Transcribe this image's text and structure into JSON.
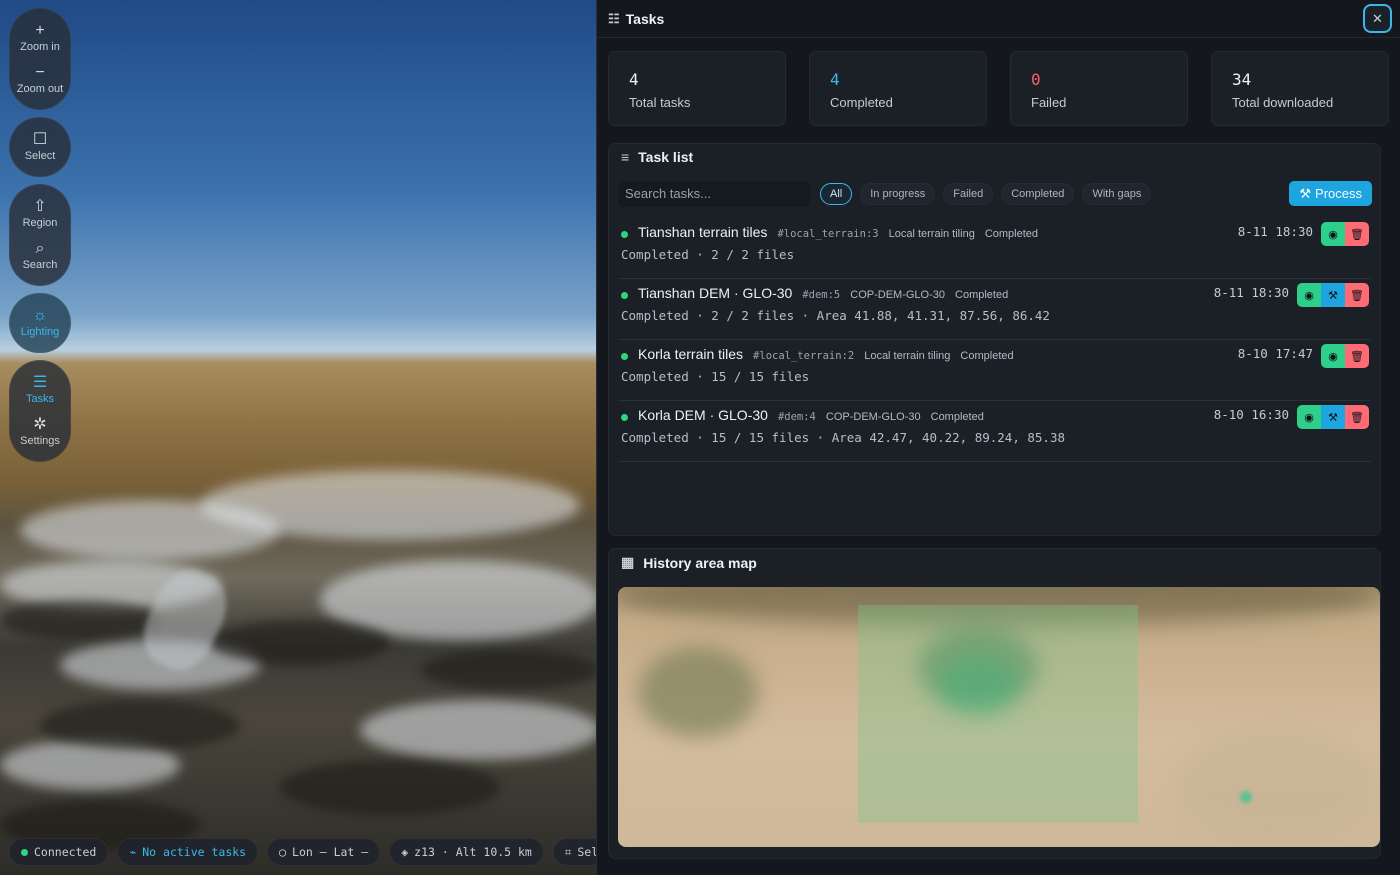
{
  "toolbar": {
    "zoom_in": "Zoom in",
    "zoom_out": "Zoom out",
    "select": "Select",
    "region": "Region",
    "search": "Search",
    "lighting": "Lighting",
    "tasks": "Tasks",
    "settings": "Settings"
  },
  "statusbar": {
    "connection": "Connected",
    "active_tasks": "No active tasks",
    "coords": "Lon — Lat —",
    "zoom_alt": "z13 · Alt 10.5 km",
    "select": "Sel"
  },
  "panel": {
    "title": "Tasks",
    "close_icon": "close-icon"
  },
  "stats": [
    {
      "value": "4",
      "label": "Total tasks"
    },
    {
      "value": "4",
      "label": "Completed"
    },
    {
      "value": "0",
      "label": "Failed"
    },
    {
      "value": "34",
      "label": "Total downloaded"
    }
  ],
  "task_list": {
    "title": "Task list",
    "search_placeholder": "Search tasks...",
    "filters": [
      "All",
      "In progress",
      "Failed",
      "Completed",
      "With gaps"
    ],
    "active_filter": "All",
    "process_label": "Process",
    "tasks": [
      {
        "name": "Tianshan terrain tiles",
        "id": "#local_terrain:3",
        "type": "Local terrain tiling",
        "status": "Completed",
        "time": "8-11 18:30",
        "detail": "Completed · 2 / 2 files",
        "has_process": false
      },
      {
        "name": "Tianshan DEM · GLO-30",
        "id": "#dem:5",
        "type": "COP-DEM-GLO-30",
        "status": "Completed",
        "time": "8-11 18:30",
        "detail": "Completed · 2 / 2 files · Area 41.88, 41.31, 87.56, 86.42",
        "has_process": true
      },
      {
        "name": "Korla terrain tiles",
        "id": "#local_terrain:2",
        "type": "Local terrain tiling",
        "status": "Completed",
        "time": "8-10 17:47",
        "detail": "Completed · 15 / 15 files",
        "has_process": false
      },
      {
        "name": "Korla DEM · GLO-30",
        "id": "#dem:4",
        "type": "COP-DEM-GLO-30",
        "status": "Completed",
        "time": "8-10 16:30",
        "detail": "Completed · 15 / 15 files · Area 42.47, 40.22, 89.24, 85.38",
        "has_process": true
      }
    ]
  },
  "history_map": {
    "title": "History area map"
  },
  "colors": {
    "accent": "#3ab8ec",
    "success": "#2ed67d",
    "danger": "#ff5d6c"
  }
}
